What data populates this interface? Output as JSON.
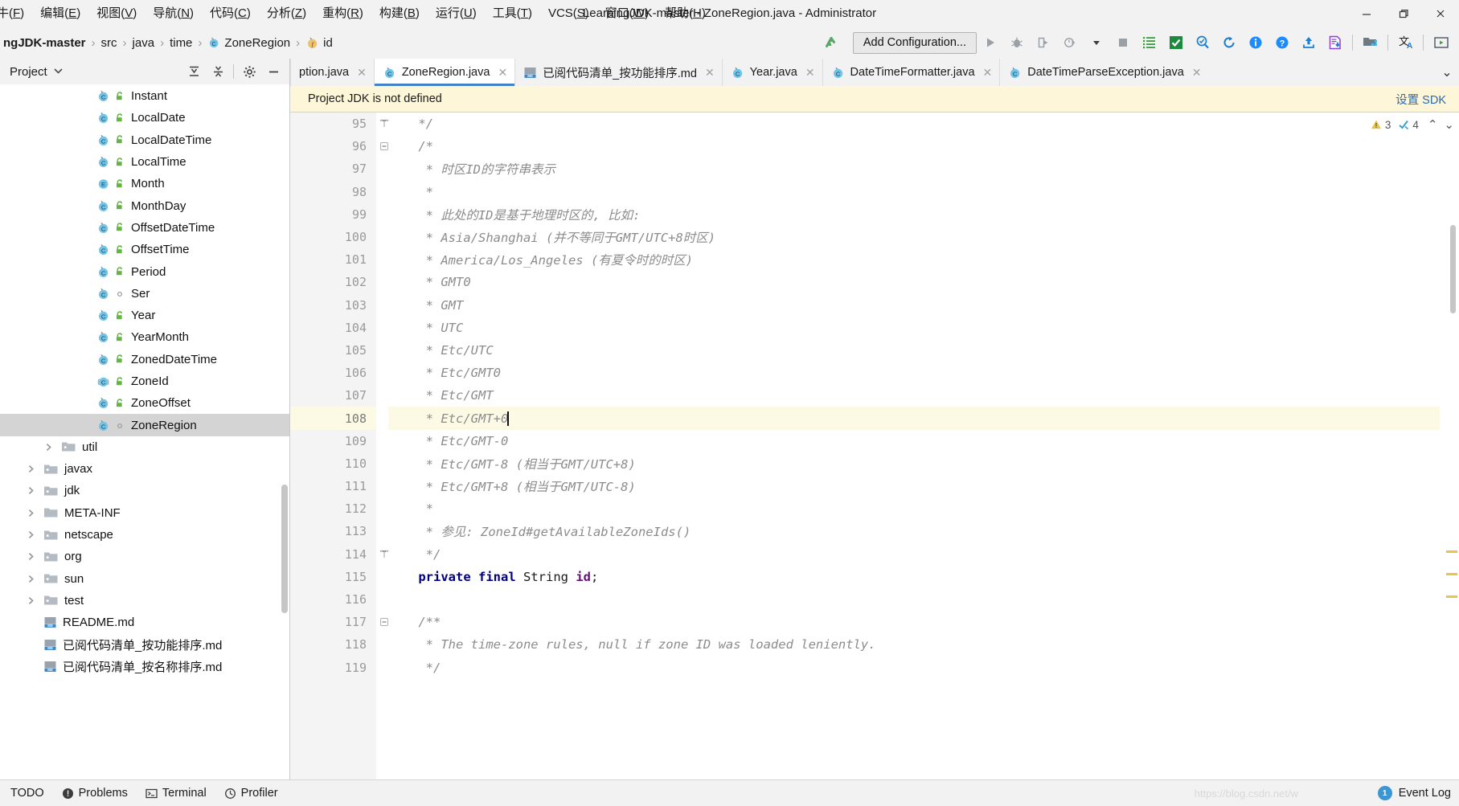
{
  "window": {
    "title": "LearningJDK-master - ZoneRegion.java - Administrator",
    "minimize_label": "Minimize",
    "restore_label": "Restore",
    "close_label": "Close"
  },
  "menubar": {
    "items": [
      {
        "label": "牛(F)",
        "name": "menu-file"
      },
      {
        "label": "编辑(E)",
        "name": "menu-edit"
      },
      {
        "label": "视图(V)",
        "name": "menu-view"
      },
      {
        "label": "导航(N)",
        "name": "menu-navigate"
      },
      {
        "label": "代码(C)",
        "name": "menu-code"
      },
      {
        "label": "分析(Z)",
        "name": "menu-analyze"
      },
      {
        "label": "重构(R)",
        "name": "menu-refactor"
      },
      {
        "label": "构建(B)",
        "name": "menu-build"
      },
      {
        "label": "运行(U)",
        "name": "menu-run"
      },
      {
        "label": "工具(T)",
        "name": "menu-tools"
      },
      {
        "label": "VCS(S)",
        "name": "menu-vcs"
      },
      {
        "label": "窗口(W)",
        "name": "menu-window"
      },
      {
        "label": "帮助(H)",
        "name": "menu-help"
      }
    ]
  },
  "breadcrumb": {
    "items": [
      {
        "label": "ngJDK-master",
        "icon": "",
        "bold": true
      },
      {
        "label": "src",
        "icon": ""
      },
      {
        "label": "java",
        "icon": ""
      },
      {
        "label": "time",
        "icon": ""
      },
      {
        "label": "ZoneRegion",
        "icon": "class-icon"
      },
      {
        "label": "id",
        "icon": "field-icon"
      }
    ],
    "separator": "›"
  },
  "toolbar": {
    "add_configuration_label": "Add Configuration...",
    "buttons": [
      {
        "name": "make-project-icon",
        "title": "Build Project"
      },
      {
        "name": "run-icon",
        "title": "Run"
      },
      {
        "name": "debug-icon",
        "title": "Debug"
      },
      {
        "name": "run-coverage-icon",
        "title": "Run with Coverage"
      },
      {
        "name": "profile-icon",
        "title": "Profile"
      },
      {
        "name": "dropdown-caret-icon",
        "title": "More"
      },
      {
        "name": "stop-icon",
        "title": "Stop"
      },
      {
        "name": "todo-list-icon",
        "title": "TODO"
      },
      {
        "name": "checkmark-icon",
        "title": "Check"
      },
      {
        "name": "search-everywhere-icon",
        "title": "Search"
      },
      {
        "name": "refresh-icon",
        "title": "Refresh"
      },
      {
        "name": "info-icon",
        "title": "Info"
      },
      {
        "name": "help-icon",
        "title": "Help"
      },
      {
        "name": "upload-icon",
        "title": "Upload"
      },
      {
        "name": "document-download-icon",
        "title": "Export"
      },
      {
        "name": "project-structure-icon",
        "title": "Project Structure"
      },
      {
        "name": "translate-icon",
        "title": "Translate"
      },
      {
        "name": "presentation-icon",
        "title": "Presentation"
      }
    ]
  },
  "sidebar": {
    "title": "Project",
    "actions": [
      {
        "name": "expand-all-icon"
      },
      {
        "name": "collapse-all-icon"
      },
      {
        "name": "settings-gear-icon"
      },
      {
        "name": "hide-panel-icon"
      }
    ],
    "tree": [
      {
        "label": "Instant",
        "icon": "java-class-icon",
        "vis": "public",
        "indent": 4,
        "arrow": false,
        "selected": false
      },
      {
        "label": "LocalDate",
        "icon": "java-class-icon",
        "vis": "public",
        "indent": 4,
        "arrow": false,
        "selected": false
      },
      {
        "label": "LocalDateTime",
        "icon": "java-class-icon",
        "vis": "public",
        "indent": 4,
        "arrow": false,
        "selected": false
      },
      {
        "label": "LocalTime",
        "icon": "java-class-icon",
        "vis": "public",
        "indent": 4,
        "arrow": false,
        "selected": false
      },
      {
        "label": "Month",
        "icon": "java-enum-icon",
        "vis": "public",
        "indent": 4,
        "arrow": false,
        "selected": false
      },
      {
        "label": "MonthDay",
        "icon": "java-class-icon",
        "vis": "public",
        "indent": 4,
        "arrow": false,
        "selected": false
      },
      {
        "label": "OffsetDateTime",
        "icon": "java-class-icon",
        "vis": "public",
        "indent": 4,
        "arrow": false,
        "selected": false
      },
      {
        "label": "OffsetTime",
        "icon": "java-class-icon",
        "vis": "public",
        "indent": 4,
        "arrow": false,
        "selected": false
      },
      {
        "label": "Period",
        "icon": "java-class-icon",
        "vis": "public",
        "indent": 4,
        "arrow": false,
        "selected": false
      },
      {
        "label": "Ser",
        "icon": "java-class-icon",
        "vis": "package",
        "indent": 4,
        "arrow": false,
        "selected": false
      },
      {
        "label": "Year",
        "icon": "java-class-icon",
        "vis": "public",
        "indent": 4,
        "arrow": false,
        "selected": false
      },
      {
        "label": "YearMonth",
        "icon": "java-class-icon",
        "vis": "public",
        "indent": 4,
        "arrow": false,
        "selected": false
      },
      {
        "label": "ZonedDateTime",
        "icon": "java-class-icon",
        "vis": "public",
        "indent": 4,
        "arrow": false,
        "selected": false
      },
      {
        "label": "ZoneId",
        "icon": "java-abstract-class-icon",
        "vis": "public",
        "indent": 4,
        "arrow": false,
        "selected": false
      },
      {
        "label": "ZoneOffset",
        "icon": "java-class-icon",
        "vis": "public",
        "indent": 4,
        "arrow": false,
        "selected": false
      },
      {
        "label": "ZoneRegion",
        "icon": "java-class-icon",
        "vis": "package",
        "indent": 4,
        "arrow": false,
        "selected": true
      },
      {
        "label": "util",
        "icon": "package-folder-icon",
        "vis": "none",
        "indent": 2,
        "arrow": true,
        "selected": false
      },
      {
        "label": "javax",
        "icon": "package-folder-icon",
        "vis": "none",
        "indent": 1,
        "arrow": true,
        "selected": false
      },
      {
        "label": "jdk",
        "icon": "package-folder-icon",
        "vis": "none",
        "indent": 1,
        "arrow": true,
        "selected": false
      },
      {
        "label": "META-INF",
        "icon": "folder-icon",
        "vis": "none",
        "indent": 1,
        "arrow": true,
        "selected": false
      },
      {
        "label": "netscape",
        "icon": "package-folder-icon",
        "vis": "none",
        "indent": 1,
        "arrow": true,
        "selected": false
      },
      {
        "label": "org",
        "icon": "package-folder-icon",
        "vis": "none",
        "indent": 1,
        "arrow": true,
        "selected": false
      },
      {
        "label": "sun",
        "icon": "package-folder-icon",
        "vis": "none",
        "indent": 1,
        "arrow": true,
        "selected": false
      },
      {
        "label": "test",
        "icon": "package-folder-icon",
        "vis": "none",
        "indent": 1,
        "arrow": true,
        "selected": false
      },
      {
        "label": "README.md",
        "icon": "markdown-icon",
        "vis": "none",
        "indent": 1,
        "arrow": false,
        "selected": false
      },
      {
        "label": "已阅代码清单_按功能排序.md",
        "icon": "markdown-icon",
        "vis": "none",
        "indent": 1,
        "arrow": false,
        "selected": false
      },
      {
        "label": "已阅代码清单_按名称排序.md",
        "icon": "markdown-icon",
        "vis": "none",
        "indent": 1,
        "arrow": false,
        "selected": false
      }
    ]
  },
  "tabs": {
    "items": [
      {
        "label": "ption.java",
        "icon": "",
        "active": false,
        "truncated": true
      },
      {
        "label": "ZoneRegion.java",
        "icon": "java-class-icon",
        "active": true
      },
      {
        "label": "已阅代码清单_按功能排序.md",
        "icon": "markdown-icon",
        "active": false
      },
      {
        "label": "Year.java",
        "icon": "java-class-icon",
        "active": false
      },
      {
        "label": "DateTimeFormatter.java",
        "icon": "java-class-icon",
        "active": false
      },
      {
        "label": "DateTimeParseException.java",
        "icon": "java-class-icon",
        "active": false
      }
    ],
    "close_glyph": "✕",
    "more_glyph": "⌄"
  },
  "notice": {
    "message": "Project JDK is not defined",
    "action": "设置 SDK"
  },
  "inspection": {
    "warning_count": "3",
    "weak_warning_count": "4",
    "up_glyph": "⌃",
    "down_glyph": "⌄"
  },
  "editor": {
    "current_line": 108,
    "lines": [
      {
        "num": 95,
        "fold": "end",
        "text": "    */",
        "tokens": [
          {
            "t": "    */",
            "c": "cmt"
          }
        ]
      },
      {
        "num": 96,
        "fold": "start",
        "text": "    /*",
        "tokens": [
          {
            "t": "    /*",
            "c": "cmt"
          }
        ]
      },
      {
        "num": 97,
        "text": "     * 时区ID的字符串表示",
        "tokens": [
          {
            "t": "     * 时区ID的字符串表示",
            "c": "cmt"
          }
        ]
      },
      {
        "num": 98,
        "text": "     *",
        "tokens": [
          {
            "t": "     *",
            "c": "cmt"
          }
        ]
      },
      {
        "num": 99,
        "text": "     * 此处的ID是基于地理时区的, 比如:",
        "tokens": [
          {
            "t": "     * 此处的ID是基于地理时区的, 比如:",
            "c": "cmt"
          }
        ]
      },
      {
        "num": 100,
        "text": "     * Asia/Shanghai (并不等同于GMT/UTC+8时区)",
        "tokens": [
          {
            "t": "     * Asia/Shanghai (并不等同于GMT/UTC+8时区)",
            "c": "cmt"
          }
        ]
      },
      {
        "num": 101,
        "text": "     * America/Los_Angeles (有夏令时的时区)",
        "tokens": [
          {
            "t": "     * America/Los_Angeles (有夏令时的时区)",
            "c": "cmt"
          }
        ]
      },
      {
        "num": 102,
        "text": "     * GMT0",
        "tokens": [
          {
            "t": "     * GMT0",
            "c": "cmt"
          }
        ]
      },
      {
        "num": 103,
        "text": "     * GMT",
        "tokens": [
          {
            "t": "     * GMT",
            "c": "cmt"
          }
        ]
      },
      {
        "num": 104,
        "text": "     * UTC",
        "tokens": [
          {
            "t": "     * UTC",
            "c": "cmt"
          }
        ]
      },
      {
        "num": 105,
        "text": "     * Etc/UTC",
        "tokens": [
          {
            "t": "     * Etc/UTC",
            "c": "cmt"
          }
        ]
      },
      {
        "num": 106,
        "text": "     * Etc/GMT0",
        "tokens": [
          {
            "t": "     * Etc/GMT0",
            "c": "cmt"
          }
        ]
      },
      {
        "num": 107,
        "text": "     * Etc/GMT",
        "tokens": [
          {
            "t": "     * Etc/GMT",
            "c": "cmt"
          }
        ]
      },
      {
        "num": 108,
        "text": "     * Etc/GMT+0",
        "bulb": true,
        "caret": true,
        "tokens": [
          {
            "t": "     * Etc/GMT+0",
            "c": "cmt"
          }
        ]
      },
      {
        "num": 109,
        "text": "     * Etc/GMT-0",
        "tokens": [
          {
            "t": "     * Etc/GMT-0",
            "c": "cmt"
          }
        ]
      },
      {
        "num": 110,
        "text": "     * Etc/GMT-8 (相当于GMT/UTC+8)",
        "tokens": [
          {
            "t": "     * Etc/GMT-8 (相当于GMT/UTC+8)",
            "c": "cmt"
          }
        ]
      },
      {
        "num": 111,
        "text": "     * Etc/GMT+8 (相当于GMT/UTC-8)",
        "tokens": [
          {
            "t": "     * Etc/GMT+8 (相当于GMT/UTC-8)",
            "c": "cmt"
          }
        ]
      },
      {
        "num": 112,
        "text": "     *",
        "tokens": [
          {
            "t": "     *",
            "c": "cmt"
          }
        ]
      },
      {
        "num": 113,
        "text": "     * 参见: ZoneId#getAvailableZoneIds()",
        "tokens": [
          {
            "t": "     * 参见: ZoneId#getAvailableZoneIds()",
            "c": "cmt"
          }
        ]
      },
      {
        "num": 114,
        "fold": "end",
        "text": "     */",
        "tokens": [
          {
            "t": "     */",
            "c": "cmt"
          }
        ]
      },
      {
        "num": 115,
        "text": "    private final String id;",
        "tokens": [
          {
            "t": "    ",
            "c": "pun"
          },
          {
            "t": "private",
            "c": "kw"
          },
          {
            "t": " ",
            "c": "pun"
          },
          {
            "t": "final",
            "c": "kw"
          },
          {
            "t": " String ",
            "c": "typ"
          },
          {
            "t": "id",
            "c": "fld"
          },
          {
            "t": ";",
            "c": "pun"
          }
        ]
      },
      {
        "num": 116,
        "text": "",
        "tokens": []
      },
      {
        "num": 117,
        "fold": "start",
        "text": "    /**",
        "tokens": [
          {
            "t": "    /**",
            "c": "cmt"
          }
        ]
      },
      {
        "num": 118,
        "text": "     * The time-zone rules, null if zone ID was loaded leniently.",
        "tokens": [
          {
            "t": "     * The time-zone rules, null if zone ID was loaded leniently.",
            "c": "cmt"
          }
        ]
      },
      {
        "num": 119,
        "text": "     */",
        "tokens": [
          {
            "t": "     */",
            "c": "cmt"
          }
        ]
      }
    ]
  },
  "statusbar": {
    "left_items": [
      {
        "label": "TODO",
        "icon": ""
      },
      {
        "label": "Problems",
        "icon": "problems-icon"
      },
      {
        "label": "Terminal",
        "icon": "terminal-icon"
      },
      {
        "label": "Profiler",
        "icon": "profiler-icon"
      }
    ],
    "event_log_label": "Event Log",
    "event_badge": "1",
    "watermark": "https://blog.csdn.net/w"
  },
  "colors": {
    "accent_blue": "#4083c9",
    "notice_bg": "#fdf6d8",
    "selection_gray": "#d4d4d4",
    "comment_gray": "#8c8c8c",
    "keyword_navy": "#000080",
    "field_purple": "#660e7a",
    "class_icon_blue": "#71c4e8",
    "public_green": "#62b543",
    "warning_yellow": "#e8c547"
  }
}
